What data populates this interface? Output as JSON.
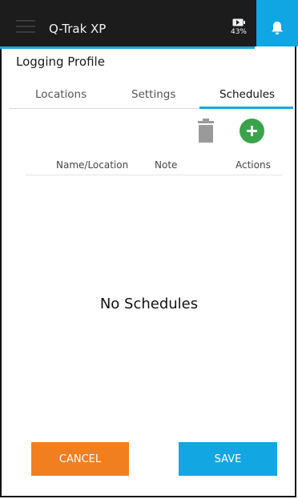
{
  "header": {
    "title": "Q-Trak XP",
    "battery_percent": "43%",
    "menu_icon": "hamburger-menu-icon",
    "battery_icon": "battery-icon",
    "bell_icon": "bell-icon",
    "colors": {
      "bar": "#1c1c1c",
      "accent": "#1aa7de",
      "bell_bg": "#0fa6e3"
    }
  },
  "page": {
    "title": "Logging Profile"
  },
  "tabs": [
    {
      "label": "Locations",
      "active": false
    },
    {
      "label": "Settings",
      "active": false
    },
    {
      "label": "Schedules",
      "active": true
    }
  ],
  "toolbar": {
    "delete_icon": "trash-icon",
    "add_icon": "add-circle-icon",
    "add_color": "#3aa24b"
  },
  "table": {
    "columns": [
      "Name/Location",
      "Note",
      "Actions"
    ],
    "empty_text": "No Schedules"
  },
  "footer": {
    "cancel_label": "CANCEL",
    "save_label": "SAVE",
    "colors": {
      "cancel": "#f27f1f",
      "save": "#12a6e2"
    }
  }
}
